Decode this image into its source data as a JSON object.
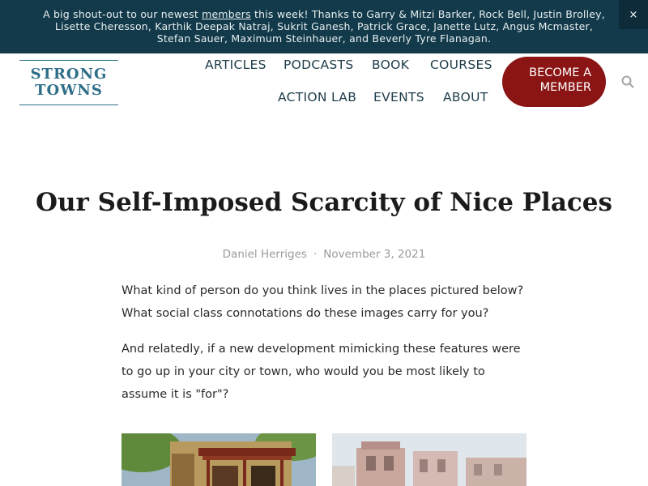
{
  "announcement": {
    "before_link": "A big shout-out to our newest ",
    "link_text": "members",
    "after_link": " this week! Thanks to Garry & Mitzi Barker, Rock Bell, Justin Brolley, Lisette Cheresson, Karthik Deepak Natraj, Sukrit Ganesh, Patrick Grace, Janette Lutz, Angus Mcmaster, Stefan Sauer, Maximum Steinhauer, and Beverly Tyre Flanagan.",
    "close_label": "×"
  },
  "logo": {
    "line1": "STRONG",
    "line2": "TOWNS"
  },
  "nav": {
    "articles": "ARTICLES",
    "podcasts": "PODCASTS",
    "book": "BOOK",
    "courses": "COURSES",
    "action_lab": "ACTION LAB",
    "events": "EVENTS",
    "about": "ABOUT"
  },
  "cta": {
    "line1": "BECOME A",
    "line2": "MEMBER"
  },
  "article": {
    "title": "Our Self-Imposed Scarcity of Nice Places",
    "author": "Daniel Herriges",
    "separator": "·",
    "date": "November 3, 2021",
    "paragraph1": "What kind of person do you think lives in the places pictured below? What social class connotations do these images carry for you?",
    "paragraph2": "And relatedly, if a new development mimicking these features were to go up in your city or town, who would you be most likely to assume it is \"for\"?"
  },
  "colors": {
    "announcement_bg": "#123a4a",
    "nav_text": "#1e3c4a",
    "cta_bg": "#8b1414",
    "logo": "#2e6e88"
  },
  "icons": {
    "close": "close-icon",
    "search": "search-icon"
  }
}
